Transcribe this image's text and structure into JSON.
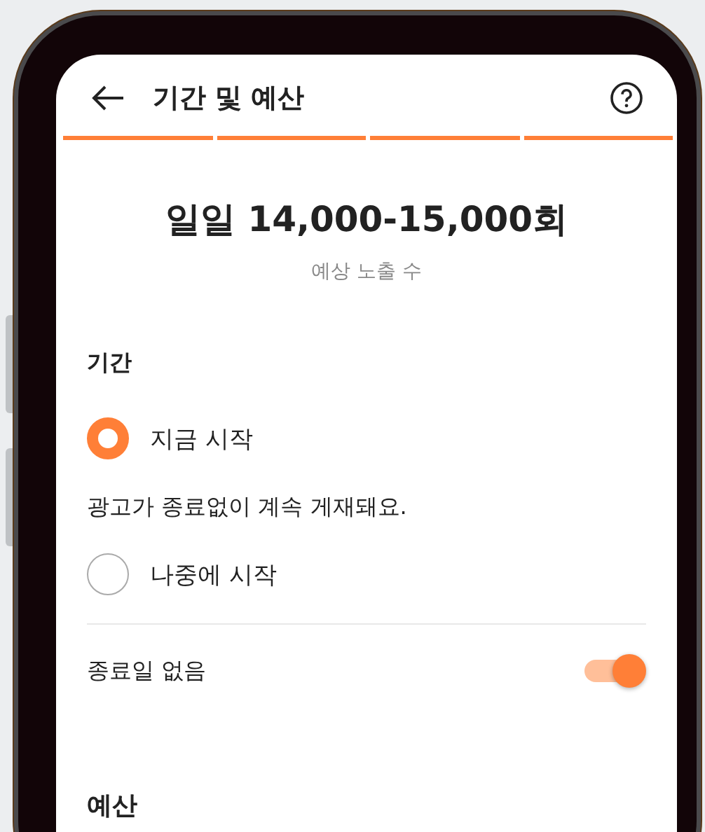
{
  "header": {
    "title": "기간 및 예산"
  },
  "progress_steps": [
    {
      "done": true
    },
    {
      "done": true
    },
    {
      "done": true
    },
    {
      "done": true
    }
  ],
  "estimate": {
    "value": "일일 14,000-15,000회",
    "caption": "예상 노출 수"
  },
  "period": {
    "heading": "기간",
    "options": [
      {
        "label": "지금 시작",
        "selected": true,
        "description": "광고가 종료없이 계속 게재돼요."
      },
      {
        "label": "나중에 시작",
        "selected": false
      }
    ],
    "no_end_date": {
      "label": "종료일 없음",
      "on": true
    }
  },
  "budget": {
    "heading": "예산"
  }
}
